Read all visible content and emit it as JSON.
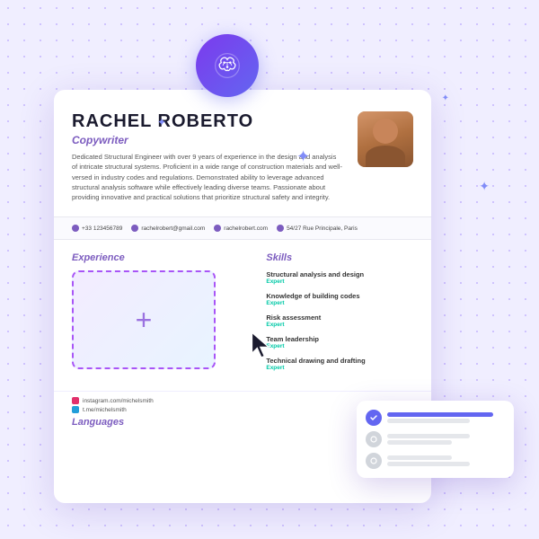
{
  "background": {
    "color": "#f0eeff"
  },
  "resume": {
    "name": "RACHEL ROBERTO",
    "title": "Copywriter",
    "bio": "Dedicated Structural Engineer with over 9 years of experience in the design and analysis of intricate structural systems. Proficient in a wide range of construction materials and well-versed in industry codes and regulations. Demonstrated ability to leverage advanced structural analysis software while effectively leading diverse teams. Passionate about providing innovative and practical solutions that prioritize structural safety and integrity.",
    "avatar_alt": "Profile photo of Rachel Roberto",
    "contact": [
      {
        "icon": "phone-icon",
        "value": "+33 123456789"
      },
      {
        "icon": "email-icon",
        "value": "rachelrobert@gmail.com"
      },
      {
        "icon": "globe-icon",
        "value": "rachelrobert.com"
      },
      {
        "icon": "location-icon",
        "value": "54/27 Rue Principale, Paris"
      }
    ],
    "sections": {
      "experience": {
        "title": "Experience",
        "add_label": "+"
      },
      "skills": {
        "title": "Skills",
        "items": [
          {
            "name": "Structural analysis and design",
            "level": "Expert"
          },
          {
            "name": "Knowledge of building codes",
            "level": "Expert"
          },
          {
            "name": "Risk assessment",
            "level": "Expert"
          },
          {
            "name": "Team leadership",
            "level": "Expert"
          },
          {
            "name": "Technical drawing and drafting",
            "level": "Expert"
          }
        ]
      }
    },
    "social": [
      {
        "platform": "Instagram",
        "handle": "instagram.com/michelsmith",
        "icon": "instagram-icon"
      },
      {
        "platform": "Telegram",
        "handle": "t.me/michelsmith",
        "icon": "telegram-icon"
      }
    ],
    "languages_section": "Languages"
  },
  "brain_icon": {
    "alt": "AI brain icon",
    "color_from": "#7c3aed",
    "color_to": "#6366f1"
  },
  "popup": {
    "rows": [
      {
        "icon_color": "blue",
        "bars": [
          "long",
          "med"
        ]
      },
      {
        "icon_color": "gray",
        "bars": [
          "med",
          "short"
        ]
      },
      {
        "icon_color": "gray",
        "bars": [
          "short",
          "med"
        ]
      }
    ]
  },
  "sparkles": [
    "✦",
    "✦",
    "✦",
    "✦"
  ],
  "cursor_alt": "Mouse cursor"
}
